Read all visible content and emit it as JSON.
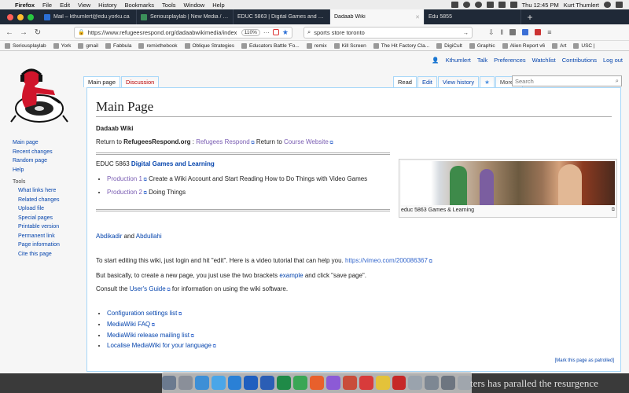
{
  "menubar": {
    "app": "Firefox",
    "items": [
      "File",
      "Edit",
      "View",
      "History",
      "Bookmarks",
      "Tools",
      "Window",
      "Help"
    ],
    "clock": "Thu 12:45 PM",
    "user": "Kurt Thumlert"
  },
  "tabs": [
    {
      "title": "Mail – kthumlert@edu.yorku.ca",
      "color": "#2b6fd6"
    },
    {
      "title": "Seriousplaylab | New Media / Yor",
      "color": "#3b8f5a"
    },
    {
      "title": "EDUC 5863 | Digital Games and Lea",
      "color": "#888888"
    },
    {
      "title": "Dadaab Wiki",
      "color": "#cccccc"
    },
    {
      "title": "Edu 5855",
      "color": "#cccccc"
    }
  ],
  "navbar": {
    "url": "https://www.refugeesrespond.org/dadaabwikimedia/index",
    "zoom": "110%",
    "dots": "···",
    "search": "sports store toronto"
  },
  "bookmarks": [
    "Seriousplaylab",
    "York",
    "gmail",
    "Fabbula",
    "remixthebook",
    "Oblique Strategies",
    "Educators Battle 'Fo...",
    "remix",
    "Kill Screen",
    "The Hit Factory Cla...",
    "DigiCult",
    "Graphic",
    "Alien Report v6",
    "Art",
    "USC |"
  ],
  "personal": {
    "user": "Kthumlert",
    "talk": "Talk",
    "preferences": "Preferences",
    "watchlist": "Watchlist",
    "contributions": "Contributions",
    "logout": "Log out"
  },
  "page_tabs": {
    "main": "Main page",
    "discussion": "Discussion",
    "read": "Read",
    "edit": "Edit",
    "history": "View history",
    "more": "More",
    "search_placeholder": "Search"
  },
  "sidebar": {
    "nav": [
      "Main page",
      "Recent changes",
      "Random page",
      "Help"
    ],
    "tools_heading": "Tools",
    "tools": [
      "What links here",
      "Related changes",
      "Upload file",
      "Special pages",
      "Printable version",
      "Permanent link",
      "Page information",
      "Cite this page"
    ]
  },
  "content": {
    "title": "Main Page",
    "wiki_name": "Dadaab Wiki",
    "return_prefix": "Return to",
    "return_site": "RefugeesRespond.org",
    "return_sep": ":",
    "refugees_respond": "Refugees Respond",
    "return_course_prefix": "Return to",
    "course_website": "Course Website",
    "course_code": "EDUC 5863",
    "course_name": "Digital Games and Learning",
    "production1_link": "Production 1",
    "production1_text": "Create a Wiki Account and Start Reading How to Do Things with Video Games",
    "production2_link": "Production 2",
    "production2_text": "Doing Things",
    "image_caption": "educ 5863 Games & Learning",
    "name1": "Abdikadir",
    "and": "and",
    "name2": "Abdullahi",
    "editing_text": "To start editing this wiki, just login and hit \"edit\". Here is a video tutorial that can help you.",
    "video_url": "https://vimeo.com/200086367",
    "basically_prefix": "But basically, to create a new page, you just use the two brackets",
    "example": "example",
    "basically_suffix": "and click \"save page\".",
    "consult_prefix": "Consult the",
    "users_guide": "User's Guide",
    "consult_suffix": "for information on using the wiki software.",
    "links": [
      "Configuration settings list",
      "MediaWiki FAQ",
      "MediaWiki release mailing list",
      "Localise MediaWiki for your language"
    ],
    "patrolled": "[Mark this page as patrolled]"
  },
  "desktop_text": "ters has paralled the resurgence",
  "colors": {
    "link": "#0645ad",
    "visited": "#795cb2",
    "tab_bar": "#1f2937",
    "border": "#a7d7f9"
  }
}
